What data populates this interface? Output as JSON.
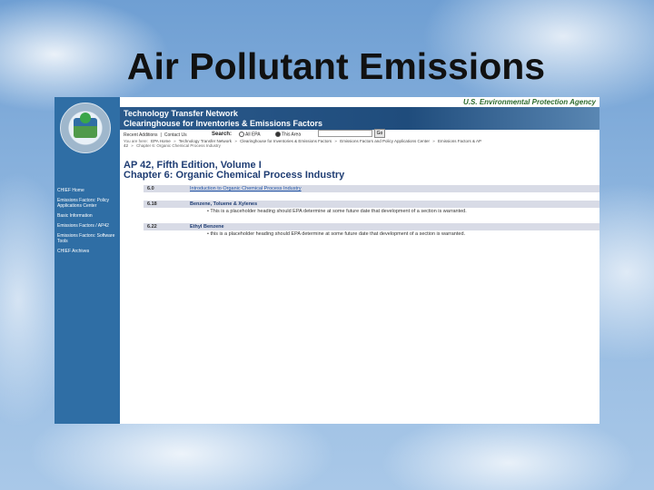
{
  "slide_title": "Air Pollutant Emissions",
  "agency": "U.S. Environmental Protection Agency",
  "banner": {
    "line1": "Technology Transfer Network",
    "line2": "Clearinghouse for Inventories & Emissions Factors"
  },
  "utility": {
    "recent_additions": "Recent Additions",
    "separator": "|",
    "contact_us": "Contact Us",
    "search_label": "Search:",
    "scope_all": "All EPA",
    "scope_this": "This Area",
    "search_value": "",
    "go_label": "Go"
  },
  "breadcrumb": {
    "prefix": "You are here:",
    "items": [
      "EPA Home",
      "Technology Transfer Network",
      "Clearinghouse for Inventories & Emissions Factors",
      "Emissions Factors and Policy Applications Center",
      "Emissions Factors & AP"
    ],
    "line2": "42",
    "line2_item": "Chapter 6: Organic Chemical Process Industry"
  },
  "sidebar": {
    "items": [
      "CHIEF Home",
      "Emissions Factors: Policy Applications Center",
      "Basic Information",
      "Emissions Factors / AP42",
      "Emissions Factors: Software Tools",
      "CHIEF Archives"
    ]
  },
  "document": {
    "title_line1": "AP 42, Fifth Edition, Volume I",
    "title_line2": "Chapter 6: Organic Chemical Process Industry"
  },
  "sections": [
    {
      "number": "6.0",
      "title": "Introduction to Organic Chemical Process Industry",
      "note": ""
    },
    {
      "number": "6.18",
      "title": "Benzene, Toluene & Xylenes",
      "note": "This is a placeholder heading should EPA determine at some future date that development of a section is warranted."
    },
    {
      "number": "6.22",
      "title": "Ethyl Benzene",
      "note": "this is a placeholder heading should EPA determine at some future date that development of a section is warranted."
    }
  ],
  "colors": {
    "sidebar": "#2f6ea5",
    "banner": "#1f4c7c",
    "section_bar": "#d8dbe6",
    "agency_text": "#2d6a2d"
  }
}
